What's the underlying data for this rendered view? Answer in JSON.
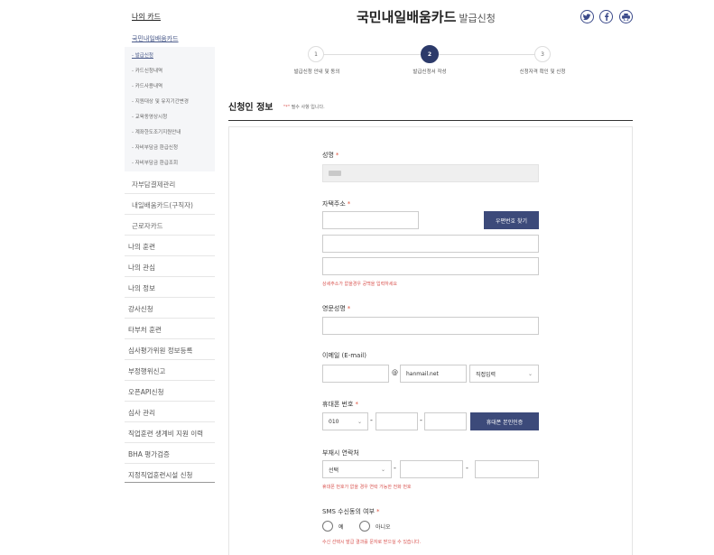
{
  "sidebar": {
    "top_label": "나의 카드",
    "sub_label": "국민내일배움카드",
    "sub_items": [
      {
        "label": "- 발급신청",
        "active": true
      },
      {
        "label": "- 카드신청내역",
        "active": false
      },
      {
        "label": "- 카드사용내역",
        "active": false
      },
      {
        "label": "- 지원대상 및 유지기간변경",
        "active": false
      },
      {
        "label": "- 교육동영상시청",
        "active": false
      },
      {
        "label": "- 계좌한도조기지원안내",
        "active": false
      },
      {
        "label": "- 자비부담금 환급신청",
        "active": false
      },
      {
        "label": "- 자비부담금 환급조회",
        "active": false
      }
    ],
    "level2": [
      "자부담결제관리",
      "내일배움카드(구직자)",
      "근로자카드"
    ],
    "level1": [
      "나의 훈련",
      "나의 관심",
      "나의 정보",
      "강사신청",
      "타부처 훈련",
      "심사평가위원 정보등록",
      "부정행위신고",
      "오픈API신청",
      "심사 관리",
      "직업훈련 생계비 지원 이력",
      "BHA 평가검증",
      "지정직업훈련시설 신청"
    ]
  },
  "header": {
    "title": "국민내일배움카드",
    "subtitle": "발급신청",
    "social_icons": [
      "twitter-icon",
      "facebook-icon",
      "print-icon"
    ],
    "accent_color": "#3b4a8a"
  },
  "steps": [
    {
      "num": "1",
      "label": "발급신청 안내 및 동의",
      "active": false
    },
    {
      "num": "2",
      "label": "발급신청서 작성",
      "active": true
    },
    {
      "num": "3",
      "label": "신청자격 확인 및 신청",
      "active": false
    }
  ],
  "section": {
    "title": "신청인 정보",
    "note_mark": "\"*\"",
    "note_text": "필수 사항 입니다."
  },
  "form": {
    "name_label": "성명",
    "address_label": "자택주소",
    "zip_button": "우편번호 찾기",
    "address_help": "상세주소가 없을경우 공백을 입력하세요",
    "eng_name_label": "영문성명",
    "email_label": "이메일 (E-mail)",
    "email_at": "@",
    "email_domain": "hanmail.net",
    "email_select": "직접입력",
    "mobile_label": "휴대폰 번호",
    "mobile_prefix": "010",
    "verify_button": "휴대폰 본인인증",
    "alt_phone_label": "부재시 연락처",
    "alt_phone_select": "선택",
    "alt_phone_help": "휴대폰 번호가 없을 경우 연락 가능한 전화 번호",
    "sms_label": "SMS 수신동의 여부",
    "sms_yes": "예",
    "sms_no": "아니오",
    "sms_help": "수신 선택시 발급 결과를 문자로 받으실 수 있습니다.",
    "required_mark": "*",
    "dash": "-"
  }
}
